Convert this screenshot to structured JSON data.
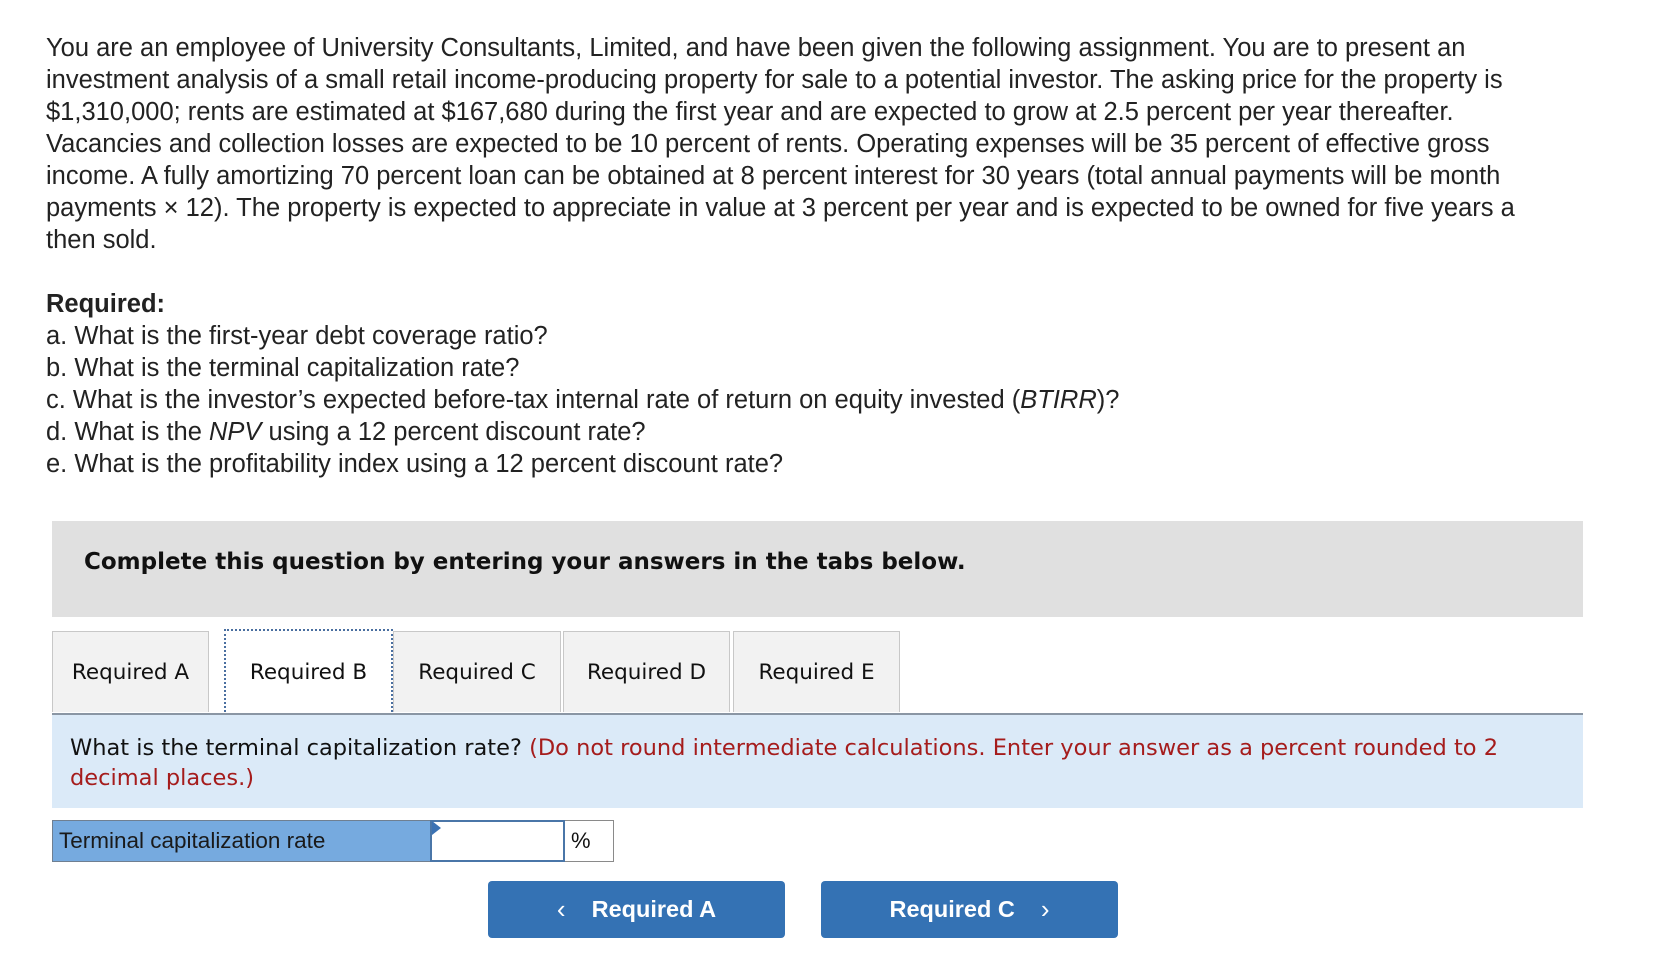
{
  "problem": {
    "lines": [
      "You are an employee of University Consultants, Limited, and have been given the following assignment. You are to present an",
      "investment analysis of a small retail income-producing property for sale to a potential investor. The asking price for the property is",
      "$1,310,000; rents are estimated at $167,680 during the first year and are expected to grow at 2.5 percent per year thereafter.",
      "Vacancies and collection losses are expected to be 10 percent of rents. Operating expenses will be 35 percent of effective gross",
      "income. A fully amortizing 70 percent loan can be obtained at 8 percent interest for 30 years (total annual payments will be month",
      "payments × 12). The property is expected to appreciate in value at 3 percent per year and is expected to be owned for five years a",
      "then sold."
    ]
  },
  "required": {
    "heading": "Required:",
    "items": [
      {
        "pre": "a. What is the first-year debt coverage ratio?",
        "em": "",
        "post": ""
      },
      {
        "pre": "b. What is the terminal capitalization rate?",
        "em": "",
        "post": ""
      },
      {
        "pre": "c. What is the investor’s expected before-tax internal rate of return on equity invested (",
        "em": "BTIRR",
        "post": ")?"
      },
      {
        "pre": "d. What is the ",
        "em": "NPV",
        "post": " using a 12 percent discount rate?"
      },
      {
        "pre": "e. What is the profitability index using a 12 percent discount rate?",
        "em": "",
        "post": ""
      }
    ]
  },
  "instruction": "Complete this question by entering your answers in the tabs below.",
  "tabs": [
    {
      "label": "Required A",
      "active": false
    },
    {
      "label": "Required B",
      "active": true
    },
    {
      "label": "Required C",
      "active": false
    },
    {
      "label": "Required D",
      "active": false
    },
    {
      "label": "Required E",
      "active": false
    }
  ],
  "question": {
    "text": "What is the terminal capitalization rate? ",
    "note": "(Do not round intermediate calculations. Enter your answer as a percent rounded to 2 decimal places.)"
  },
  "answer": {
    "label": "Terminal capitalization rate",
    "value": "",
    "placeholder": "",
    "unit": "%"
  },
  "nav": {
    "prev_label": "Required A",
    "prev_icon": "‹",
    "next_label": "Required C",
    "next_icon": "›"
  },
  "colors": {
    "instruction_bg": "#e0e0e0",
    "question_bg": "#dbeaf8",
    "note_text": "#a51c1c",
    "answer_label_bg": "#76aadf",
    "button_bg": "#3472b4"
  }
}
